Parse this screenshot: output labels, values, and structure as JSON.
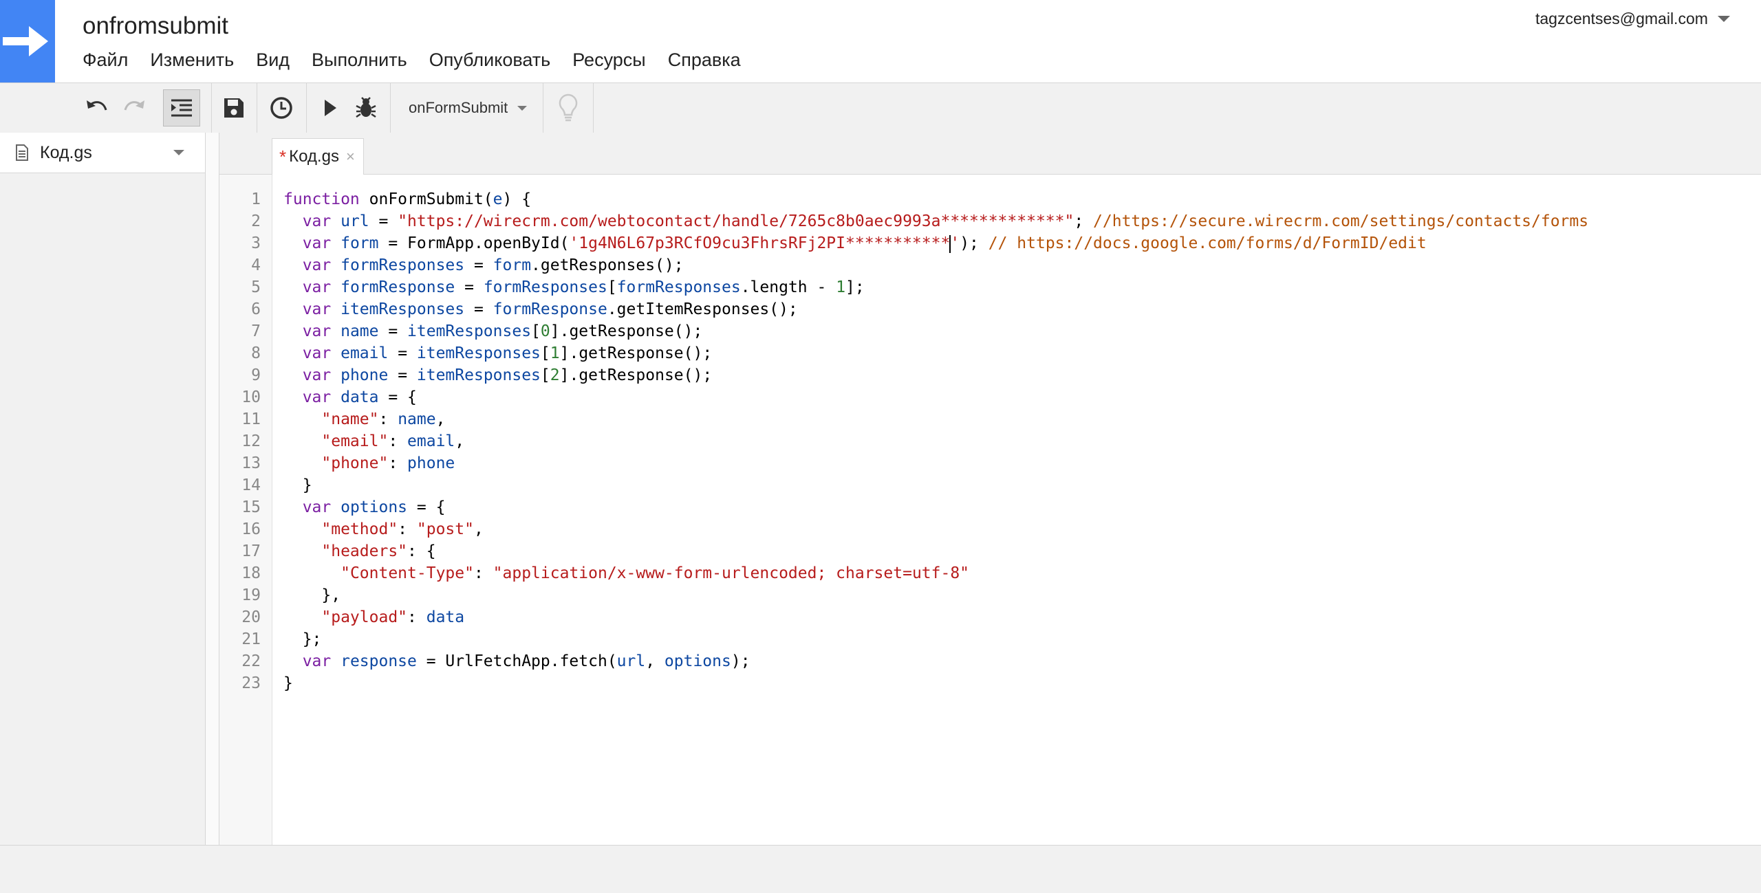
{
  "app": {
    "title": "onfromsubmit",
    "account": "tagzcentses@gmail.com",
    "accent": "#4285f4"
  },
  "menu": [
    "Файл",
    "Изменить",
    "Вид",
    "Выполнить",
    "Опубликовать",
    "Ресурсы",
    "Справка"
  ],
  "toolbar": {
    "icons": [
      "undo-icon",
      "redo-icon",
      "indent-icon",
      "save-icon",
      "triggers-clock-icon",
      "run-icon",
      "debug-icon",
      "lightbulb-icon"
    ],
    "function_select": "onFormSubmit"
  },
  "sidebar": {
    "files": [
      "Код.gs"
    ]
  },
  "editor": {
    "tab": {
      "modified_mark": "*",
      "label": "Код.gs",
      "close": "×"
    },
    "lines": [
      [
        {
          "t": "function ",
          "c": "kw"
        },
        {
          "t": "onFormSubmit(",
          "c": ""
        },
        {
          "t": "e",
          "c": "vr"
        },
        {
          "t": ") {",
          "c": ""
        }
      ],
      [
        {
          "t": "  var ",
          "c": "kw"
        },
        {
          "t": "url",
          "c": "vr"
        },
        {
          "t": " = ",
          "c": ""
        },
        {
          "t": "\"https://wirecrm.com/webtocontact/handle/7265c8b0aec9993a*************\"",
          "c": "st"
        },
        {
          "t": "; ",
          "c": ""
        },
        {
          "t": "//https://secure.wirecrm.com/settings/contacts/forms",
          "c": "cm"
        }
      ],
      [
        {
          "t": "  var ",
          "c": "kw"
        },
        {
          "t": "form",
          "c": "vr"
        },
        {
          "t": " = FormApp.openById(",
          "c": ""
        },
        {
          "t": "'1g4N6L67p3RCfO9cu3FhrsRFj2PI***********",
          "c": "st"
        },
        {
          "t": "",
          "c": "",
          "cursor": true
        },
        {
          "t": "'",
          "c": "st"
        },
        {
          "t": "); ",
          "c": ""
        },
        {
          "t": "// https://docs.google.com/forms/d/FormID/edit",
          "c": "cm"
        }
      ],
      [
        {
          "t": "  var ",
          "c": "kw"
        },
        {
          "t": "formResponses",
          "c": "vr"
        },
        {
          "t": " = ",
          "c": ""
        },
        {
          "t": "form",
          "c": "vr"
        },
        {
          "t": ".getResponses();",
          "c": ""
        }
      ],
      [
        {
          "t": "  var ",
          "c": "kw"
        },
        {
          "t": "formResponse",
          "c": "vr"
        },
        {
          "t": " = ",
          "c": ""
        },
        {
          "t": "formResponses",
          "c": "vr"
        },
        {
          "t": "[",
          "c": ""
        },
        {
          "t": "formResponses",
          "c": "vr"
        },
        {
          "t": ".length - ",
          "c": ""
        },
        {
          "t": "1",
          "c": "nm"
        },
        {
          "t": "];",
          "c": ""
        }
      ],
      [
        {
          "t": "  var ",
          "c": "kw"
        },
        {
          "t": "itemResponses",
          "c": "vr"
        },
        {
          "t": " = ",
          "c": ""
        },
        {
          "t": "formResponse",
          "c": "vr"
        },
        {
          "t": ".getItemResponses();",
          "c": ""
        }
      ],
      [
        {
          "t": "  var ",
          "c": "kw"
        },
        {
          "t": "name",
          "c": "vr"
        },
        {
          "t": " = ",
          "c": ""
        },
        {
          "t": "itemResponses",
          "c": "vr"
        },
        {
          "t": "[",
          "c": ""
        },
        {
          "t": "0",
          "c": "nm"
        },
        {
          "t": "].getResponse();",
          "c": ""
        }
      ],
      [
        {
          "t": "  var ",
          "c": "kw"
        },
        {
          "t": "email",
          "c": "vr"
        },
        {
          "t": " = ",
          "c": ""
        },
        {
          "t": "itemResponses",
          "c": "vr"
        },
        {
          "t": "[",
          "c": ""
        },
        {
          "t": "1",
          "c": "nm"
        },
        {
          "t": "].getResponse();",
          "c": ""
        }
      ],
      [
        {
          "t": "  var ",
          "c": "kw"
        },
        {
          "t": "phone",
          "c": "vr"
        },
        {
          "t": " = ",
          "c": ""
        },
        {
          "t": "itemResponses",
          "c": "vr"
        },
        {
          "t": "[",
          "c": ""
        },
        {
          "t": "2",
          "c": "nm"
        },
        {
          "t": "].getResponse();",
          "c": ""
        }
      ],
      [
        {
          "t": "  var ",
          "c": "kw"
        },
        {
          "t": "data",
          "c": "vr"
        },
        {
          "t": " = {",
          "c": ""
        }
      ],
      [
        {
          "t": "    ",
          "c": ""
        },
        {
          "t": "\"name\"",
          "c": "st"
        },
        {
          "t": ": ",
          "c": ""
        },
        {
          "t": "name",
          "c": "vr"
        },
        {
          "t": ",",
          "c": ""
        }
      ],
      [
        {
          "t": "    ",
          "c": ""
        },
        {
          "t": "\"email\"",
          "c": "st"
        },
        {
          "t": ": ",
          "c": ""
        },
        {
          "t": "email",
          "c": "vr"
        },
        {
          "t": ",",
          "c": ""
        }
      ],
      [
        {
          "t": "    ",
          "c": ""
        },
        {
          "t": "\"phone\"",
          "c": "st"
        },
        {
          "t": ": ",
          "c": ""
        },
        {
          "t": "phone",
          "c": "vr"
        }
      ],
      [
        {
          "t": "  }",
          "c": ""
        }
      ],
      [
        {
          "t": "  var ",
          "c": "kw"
        },
        {
          "t": "options",
          "c": "vr"
        },
        {
          "t": " = {",
          "c": ""
        }
      ],
      [
        {
          "t": "    ",
          "c": ""
        },
        {
          "t": "\"method\"",
          "c": "st"
        },
        {
          "t": ": ",
          "c": ""
        },
        {
          "t": "\"post\"",
          "c": "st"
        },
        {
          "t": ",",
          "c": ""
        }
      ],
      [
        {
          "t": "    ",
          "c": ""
        },
        {
          "t": "\"headers\"",
          "c": "st"
        },
        {
          "t": ": {",
          "c": ""
        }
      ],
      [
        {
          "t": "      ",
          "c": ""
        },
        {
          "t": "\"Content-Type\"",
          "c": "st"
        },
        {
          "t": ": ",
          "c": ""
        },
        {
          "t": "\"application/x-www-form-urlencoded; charset=utf-8\"",
          "c": "st"
        }
      ],
      [
        {
          "t": "    },",
          "c": ""
        }
      ],
      [
        {
          "t": "    ",
          "c": ""
        },
        {
          "t": "\"payload\"",
          "c": "st"
        },
        {
          "t": ": ",
          "c": ""
        },
        {
          "t": "data",
          "c": "vr"
        }
      ],
      [
        {
          "t": "  };",
          "c": ""
        }
      ],
      [
        {
          "t": "  var ",
          "c": "kw"
        },
        {
          "t": "response",
          "c": "vr"
        },
        {
          "t": " = UrlFetchApp.fetch(",
          "c": ""
        },
        {
          "t": "url",
          "c": "vr"
        },
        {
          "t": ", ",
          "c": ""
        },
        {
          "t": "options",
          "c": "vr"
        },
        {
          "t": ");",
          "c": ""
        }
      ],
      [
        {
          "t": "}",
          "c": ""
        }
      ]
    ]
  }
}
